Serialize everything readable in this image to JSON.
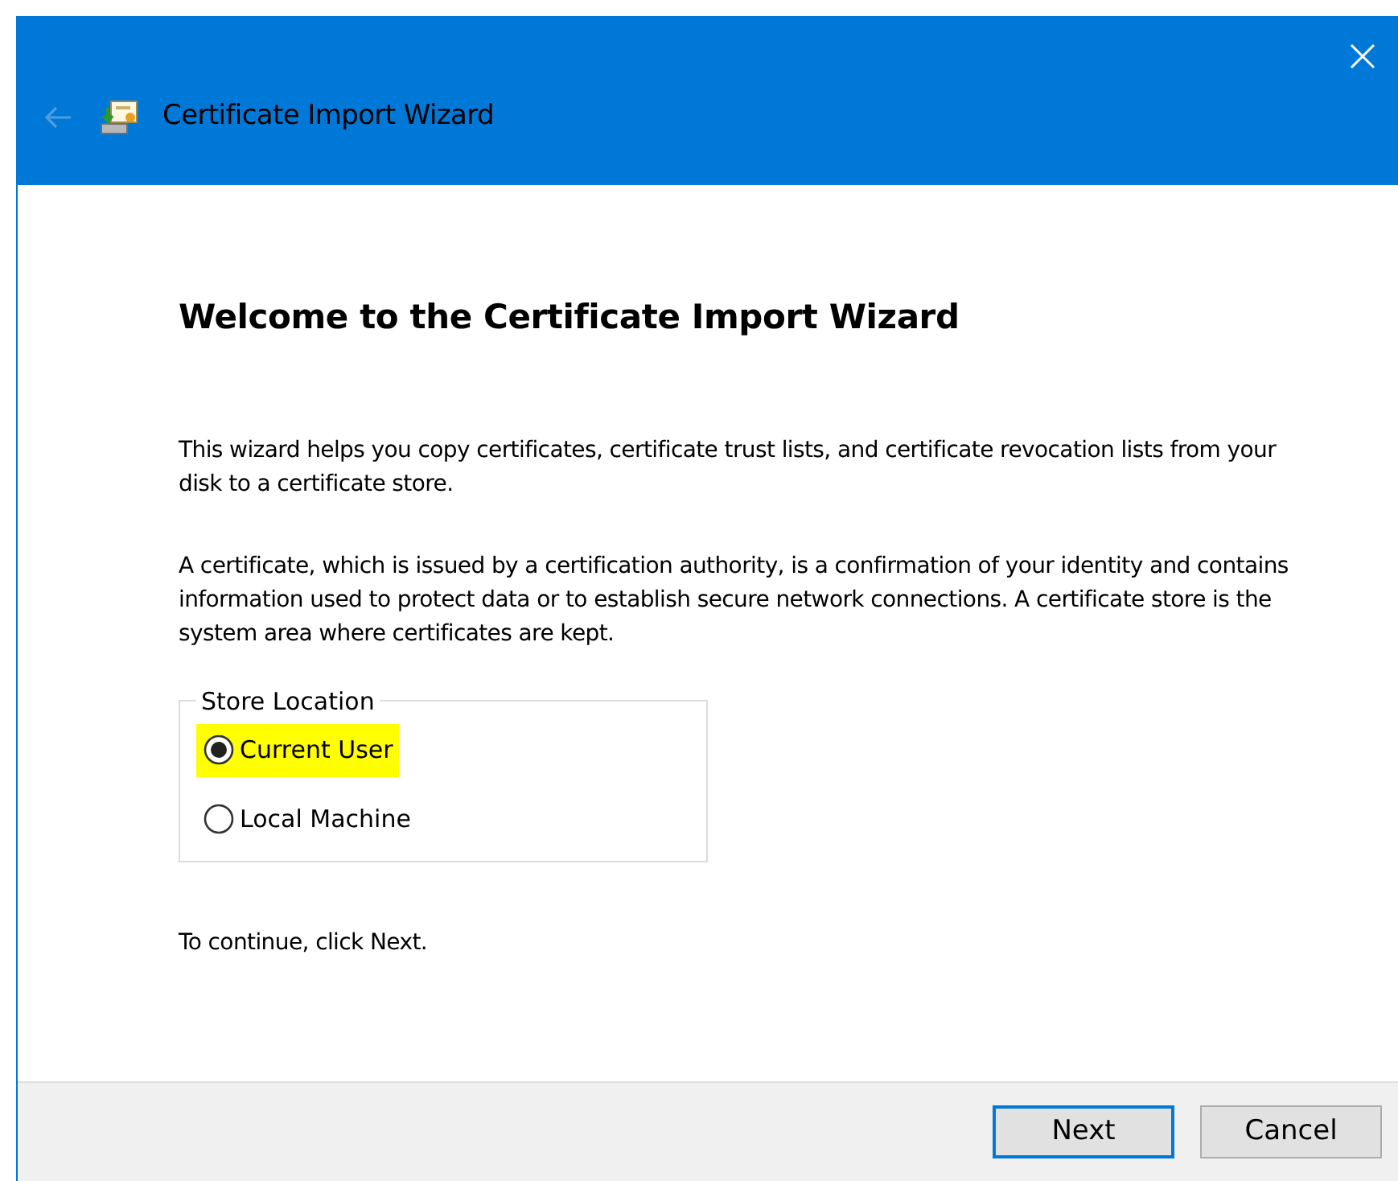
{
  "window": {
    "title": "Certificate Import Wizard",
    "back_disabled": true
  },
  "heading": "Welcome to the Certificate Import Wizard",
  "paragraphs": [
    "This wizard helps you copy certificates, certificate trust lists, and certificate revocation lists from your disk to a certificate store.",
    "A certificate, which is issued by a certification authority, is a confirmation of your identity and contains information used to protect data or to establish secure network connections. A certificate store is the system area where certificates are kept."
  ],
  "store_location": {
    "legend": "Store Location",
    "options": [
      {
        "label": "Current User",
        "selected": true,
        "highlighted": true
      },
      {
        "label": "Local Machine",
        "selected": false,
        "highlighted": false
      }
    ]
  },
  "hint": "To continue, click Next.",
  "buttons": [
    {
      "label": "Next",
      "default": true
    },
    {
      "label": "Cancel",
      "default": false
    }
  ]
}
